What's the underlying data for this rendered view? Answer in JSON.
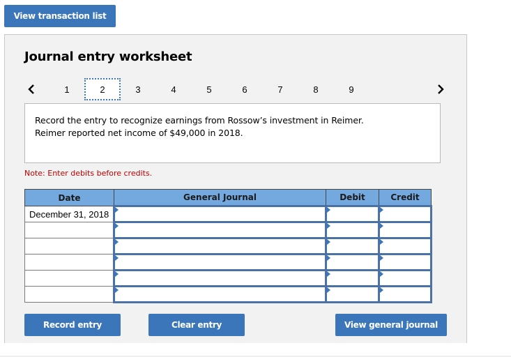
{
  "top_button": {
    "label": "View transaction list"
  },
  "worksheet": {
    "title": "Journal entry worksheet",
    "pager": {
      "prev_icon": "chevron-left-icon",
      "next_icon": "chevron-right-icon",
      "pages": [
        "1",
        "2",
        "3",
        "4",
        "5",
        "6",
        "7",
        "8",
        "9"
      ],
      "active_page": "2"
    },
    "prompt": {
      "line1": "Record the entry to recognize earnings from Rossow’s investment in Reimer.",
      "line2": "Reimer reported net income of $49,000 in 2018."
    },
    "note": "Note: Enter debits before credits.",
    "table": {
      "columns": [
        "Date",
        "General Journal",
        "Debit",
        "Credit"
      ],
      "rows": [
        {
          "date": "December 31, 2018",
          "account": "",
          "debit": "",
          "credit": ""
        },
        {
          "date": "",
          "account": "",
          "debit": "",
          "credit": ""
        },
        {
          "date": "",
          "account": "",
          "debit": "",
          "credit": ""
        },
        {
          "date": "",
          "account": "",
          "debit": "",
          "credit": ""
        },
        {
          "date": "",
          "account": "",
          "debit": "",
          "credit": ""
        },
        {
          "date": "",
          "account": "",
          "debit": "",
          "credit": ""
        }
      ]
    },
    "buttons": {
      "record": "Record entry",
      "clear": "Clear entry",
      "view_journal": "View general journal"
    }
  },
  "colors": {
    "button_blue": "#3a76b9",
    "header_blue": "#74a9e0",
    "input_border": "#4a72a6",
    "note_red": "#c00000",
    "panel_bg": "#f2f2f2"
  }
}
